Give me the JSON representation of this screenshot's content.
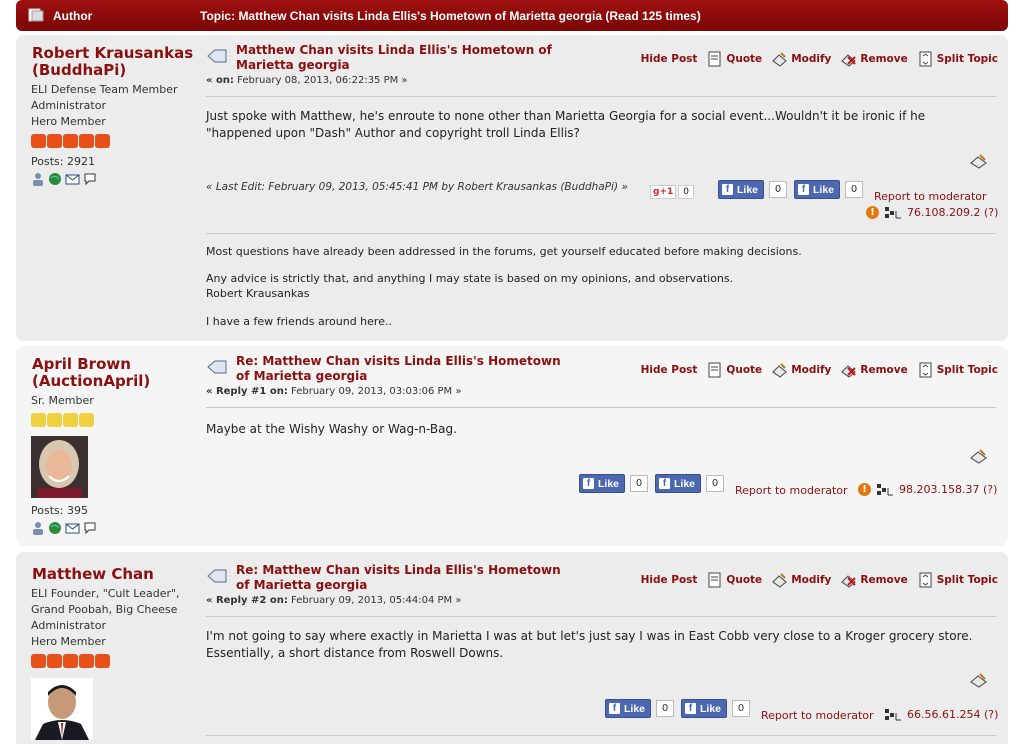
{
  "header": {
    "author_label": "Author",
    "topic_label": "Topic: Matthew Chan visits Linda Ellis's Hometown of Marietta georgia  (Read 125 times)"
  },
  "actions": {
    "hide_post": "Hide Post",
    "quote": "Quote",
    "modify": "Modify",
    "remove": "Remove",
    "split_topic": "Split Topic",
    "report": "Report to moderator",
    "fb_like": "Like"
  },
  "posts": [
    {
      "poster_name": "Robert Krausankas (BuddhaPi)",
      "info_lines": [
        "ELI Defense Team Member",
        "Administrator",
        "Hero Member"
      ],
      "posts_count": "Posts: 2921",
      "subject": "Matthew Chan visits Linda Ellis's Hometown of Marietta georgia",
      "date_prefix": "« on:",
      "date": "February 08, 2013, 06:22:35 PM »",
      "body": "Just spoke with Matthew, he's enroute to none other than Marietta Georgia for a social event...Wouldn't it be ironic if he \"happened upon \"Dash\" Author and copyright troll Linda Ellis?",
      "last_edit": "« Last Edit: February 09, 2013, 05:45:41 PM by Robert Krausankas (BuddhaPi) »",
      "gplus": "g+1",
      "gplus_count": "0",
      "fb_counts": [
        "0",
        "0"
      ],
      "ip": "76.108.209.2 (?)",
      "signature": [
        "Most questions have already been addressed in the forums, get yourself educated before making decisions.",
        "Any advice is strictly that, and anything I may state is based on my opinions, and observations.",
        "Robert Krausankas",
        "I have a few friends around here.."
      ]
    },
    {
      "poster_name": "April Brown (AuctionApril)",
      "info_lines": [
        "Sr. Member"
      ],
      "posts_count": "Posts: 395",
      "subject": "Re: Matthew Chan visits Linda Ellis's Hometown of Marietta georgia",
      "date_prefix": "« Reply #1 on:",
      "date": "February 09, 2013, 03:03:06 PM »",
      "body": "Maybe at the Wishy Washy or Wag-n-Bag.",
      "fb_counts": [
        "0",
        "0"
      ],
      "ip": "98.203.158.37 (?)"
    },
    {
      "poster_name": "Matthew Chan",
      "info_lines": [
        "ELI Founder, \"Cult Leader\",",
        "Grand Poobah, Big Cheese",
        "Administrator",
        "Hero Member"
      ],
      "subject": "Re: Matthew Chan visits Linda Ellis's Hometown of Marietta georgia",
      "date_prefix": "« Reply #2 on:",
      "date": "February 09, 2013, 05:44:04 PM »",
      "body": "I'm not going to say where exactly in Marietta I was at but let's just say I was in East Cobb very close to a Kroger grocery store. Essentially, a short distance from Roswell Downs.",
      "fb_counts": [
        "0",
        "0"
      ],
      "ip": "66.56.61.254 (?)"
    }
  ]
}
